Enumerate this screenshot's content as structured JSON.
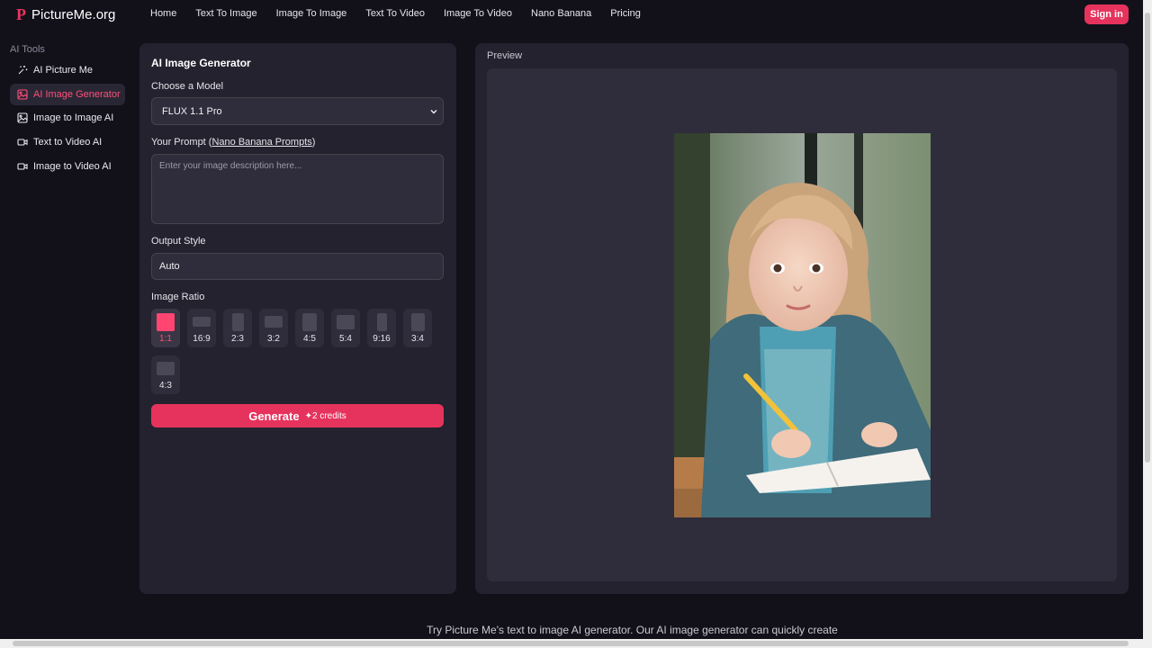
{
  "brand": {
    "mark": "P",
    "name": "PictureMe.org"
  },
  "nav": [
    "Home",
    "Text To Image",
    "Image To Image",
    "Text To Video",
    "Image To Video",
    "Nano Banana",
    "Pricing"
  ],
  "signin_label": "Sign in",
  "sidebar": {
    "heading": "AI Tools",
    "items": [
      {
        "label": "AI Picture Me",
        "icon": "magic-wand-icon"
      },
      {
        "label": "AI Image Generator",
        "icon": "image-icon",
        "active": true
      },
      {
        "label": "Image to Image AI",
        "icon": "image-icon"
      },
      {
        "label": "Text to Video AI",
        "icon": "video-camera-icon"
      },
      {
        "label": "Image to Video AI",
        "icon": "video-camera-icon"
      }
    ]
  },
  "form": {
    "title": "AI Image Generator",
    "model_label": "Choose a Model",
    "model_value": "FLUX 1.1 Pro",
    "prompt_label_prefix": "Your Prompt (",
    "prompt_link": "Nano Banana Prompts",
    "prompt_label_suffix": ")",
    "prompt_placeholder": "Enter your image description here...",
    "style_label": "Output Style",
    "style_value": "Auto",
    "ratio_label": "Image Ratio",
    "ratios": [
      "1:1",
      "16:9",
      "2:3",
      "3:2",
      "4:5",
      "5:4",
      "9:16",
      "3:4",
      "4:3"
    ],
    "selected_ratio": "1:1",
    "generate_label": "Generate",
    "generate_credits": "2 credits"
  },
  "preview": {
    "title": "Preview"
  },
  "footer_text": "Try Picture Me's text to image AI generator. Our AI image generator can quickly create",
  "colors": {
    "accent": "#e5335d",
    "background": "#12111a",
    "panel": "#24222f"
  }
}
